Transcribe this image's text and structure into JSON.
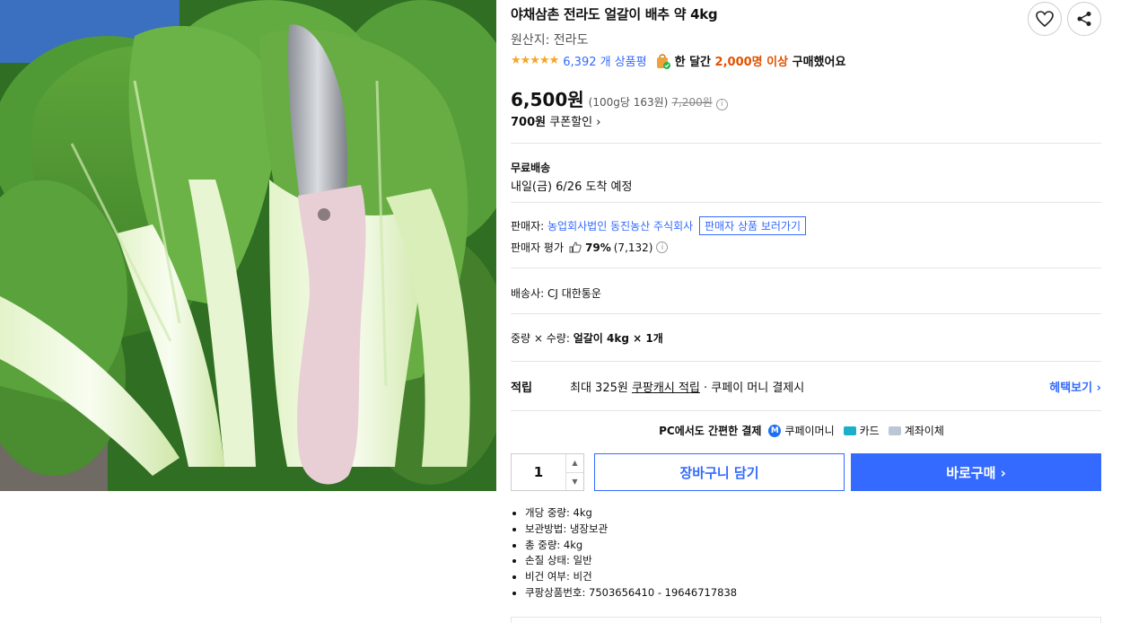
{
  "product": {
    "title": "야채삼촌 전라도 얼갈이 배추 약 4kg",
    "origin": "원산지: 전라도",
    "rating_stars": "★★★★★",
    "review_count": "6,392 개 상품평",
    "bought_prefix": "한 달간",
    "bought_num": "2,000명 이상",
    "bought_suffix": "구매했어요",
    "price": "6,500원",
    "unit_price": "(100g당 163원)",
    "original_price": "7,200원",
    "coupon_amount": "700원",
    "coupon_text": "쿠폰할인"
  },
  "delivery": {
    "label": "무료배송",
    "eta": "내일(금) 6/26 도착 예정"
  },
  "seller": {
    "label": "판매자:",
    "name": "농업회사법인 동진농산 주식회사",
    "button": "판매자 상품 보러가기",
    "rating_label": "판매자 평가",
    "rating_pct": "79%",
    "rating_count": "(7,132)"
  },
  "shipping": {
    "text": "배송사:  CJ 대한통운"
  },
  "option": {
    "label": "중량 × 수량:",
    "value": "얼갈이 4kg × 1개"
  },
  "reward": {
    "label": "적립",
    "prefix": "최대 325원",
    "cash": "쿠팡캐시 적립",
    "suffix": "· 쿠페이 머니 결제시",
    "link": "헤택보기 ›"
  },
  "payment": {
    "title": "PC에서도 간편한 결제",
    "methods": [
      "쿠페이머니",
      "카드",
      "계좌이체"
    ]
  },
  "purchase": {
    "quantity": "1",
    "cart_label": "장바구니 담기",
    "buy_label": "바로구매 ›"
  },
  "attributes": [
    "개당 중량: 4kg",
    "보관방법: 냉장보관",
    "총 중량: 4kg",
    "손질 상태: 일반",
    "비건 여부: 비건",
    "쿠팡상품번호: 7503656410 - 19646717838"
  ],
  "icons": {
    "like": "heart-icon",
    "share": "share-icon",
    "info": "info-icon",
    "thumb": "thumbs-up-icon"
  },
  "colors": {
    "accent": "#346aff",
    "highlight": "#e05200",
    "star": "#f5a623"
  }
}
